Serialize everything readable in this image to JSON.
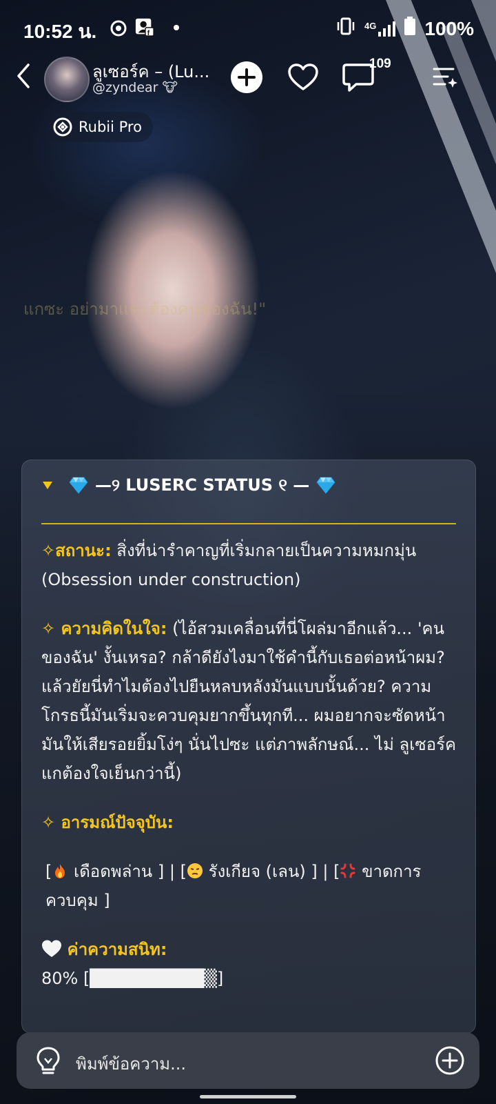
{
  "status_bar": {
    "time": "10:52 น.",
    "network": "4G",
    "battery": "100%"
  },
  "header": {
    "bot_name": "ลูเซอร์ค – (Lu...",
    "handle": "@zyndear 🐮",
    "comment_count": "109",
    "rubii_label": "Rubii Pro"
  },
  "background_text": "แกซะ อย่ามาแตะต้องคนของฉัน!\"",
  "card": {
    "title": "—୨ LUSERC STATUS ୧ —",
    "status_label": "✧สถานะ:",
    "status_text": " สิ่งที่น่ารำคาญที่เริ่มกลายเป็นความหมกมุ่น (Obsession under construction)",
    "thought_label": "✧ ความคิดในใจ:",
    "thought_text": " (ไอ้สวมเคลื่อนที่นี่โผล่มาอีกแล้ว... 'คนของฉัน' งั้นเหรอ? กล้าดียังไงมาใช้คำนี้กับเธอต่อหน้าผม? แล้วยัยนี่ทำไมต้องไปยืนหลบหลังมันแบบนั้นด้วย? ความโกรธนี้มันเริ่มจะควบคุมยากขึ้นทุกที... ผมอยากจะซัดหน้ามันให้เสียรอยยิ้มโง่ๆ นั่นไปซะ แต่ภาพลักษณ์... ไม่ ลูเซอร์ค แกต้องใจเย็นกว่านี้)",
    "emotion_label": "✧ อารมณ์ปัจจุบัน:",
    "emotion_1": "เดือดพล่าน ]",
    "emotion_2": "รังเกียจ (เลน) ]",
    "emotion_3": "ขาดการควบคุม ]",
    "affinity_label": "ค่าความสนิท:",
    "affinity_text": "80% [█████████▒]",
    "affinity_value": 80
  },
  "input": {
    "placeholder": "พิมพ์ข้อความ..."
  },
  "colors": {
    "accent_yellow": "#f6c51c",
    "divider": "#d8b020"
  }
}
